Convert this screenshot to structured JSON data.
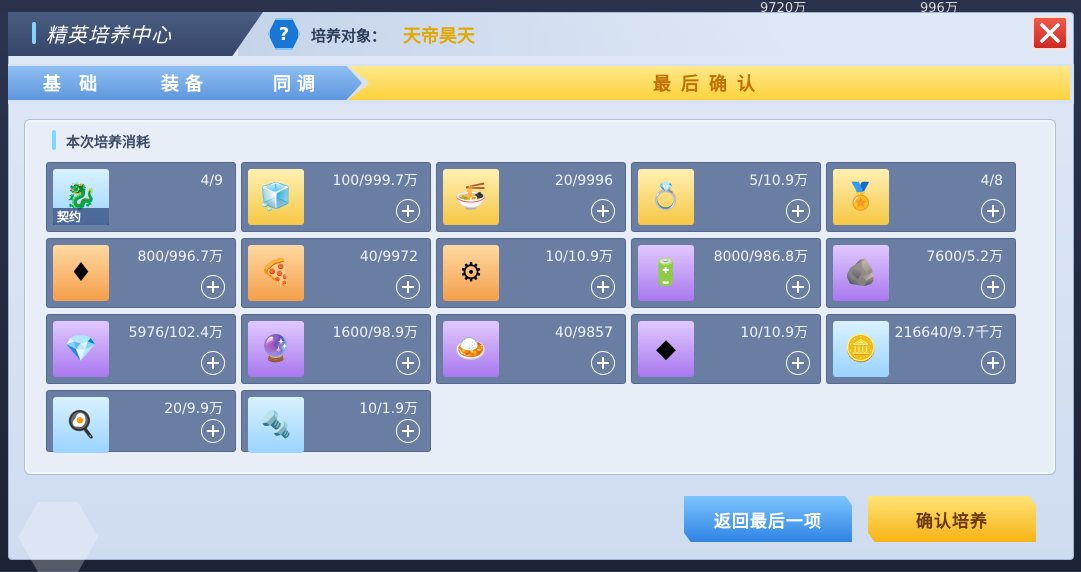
{
  "background": {
    "res_a": "9720万",
    "res_b": "996万"
  },
  "header": {
    "title": "精英培养中心",
    "target_label": "培养对象：",
    "target_name": "天帝昊天"
  },
  "steps": [
    "基 础",
    "装备",
    "同调"
  ],
  "final_step": "最后确认",
  "section": {
    "title": "本次培养消耗"
  },
  "items": [
    {
      "icon": "contract-card-icon",
      "qty": "4/9",
      "tag": "契约",
      "plus": false,
      "color": "blue"
    },
    {
      "icon": "blue-cube-icon",
      "qty": "100/999.7万",
      "plus": true,
      "color": "gold"
    },
    {
      "icon": "food-bowl-icon",
      "qty": "20/9996",
      "plus": true,
      "color": "gold"
    },
    {
      "icon": "gold-ring-icon",
      "qty": "5/10.9万",
      "plus": true,
      "color": "gold"
    },
    {
      "icon": "gold-emblem-icon",
      "qty": "4/8",
      "plus": true,
      "color": "gold"
    },
    {
      "icon": "red-gem-icon",
      "qty": "800/996.7万",
      "plus": true,
      "color": "orange"
    },
    {
      "icon": "pizza-icon",
      "qty": "40/9972",
      "plus": true,
      "color": "orange"
    },
    {
      "icon": "mech-part-icon",
      "qty": "10/10.9万",
      "plus": true,
      "color": "orange"
    },
    {
      "icon": "energy-can-icon",
      "qty": "8000/986.8万",
      "plus": true,
      "color": "purple"
    },
    {
      "icon": "gold-ore-icon",
      "qty": "7600/5.2万",
      "plus": true,
      "color": "purple"
    },
    {
      "icon": "gold-crystal-icon",
      "qty": "5976/102.4万",
      "plus": true,
      "color": "purple"
    },
    {
      "icon": "purple-crystal-icon",
      "qty": "1600/98.9万",
      "plus": true,
      "color": "purple"
    },
    {
      "icon": "dish-icon",
      "qty": "40/9857",
      "plus": true,
      "color": "purple"
    },
    {
      "icon": "purple-part-icon",
      "qty": "10/10.9万",
      "plus": true,
      "color": "purple"
    },
    {
      "icon": "gold-coin-icon",
      "qty": "216640/9.7千万",
      "plus": true,
      "color": "blue"
    },
    {
      "icon": "omelet-icon",
      "qty": "20/9.9万",
      "plus": true,
      "color": "blue"
    },
    {
      "icon": "silver-part-icon",
      "qty": "10/1.9万",
      "plus": true,
      "color": "blue"
    }
  ],
  "buttons": {
    "back": "返回最后一项",
    "confirm": "确认培养"
  }
}
